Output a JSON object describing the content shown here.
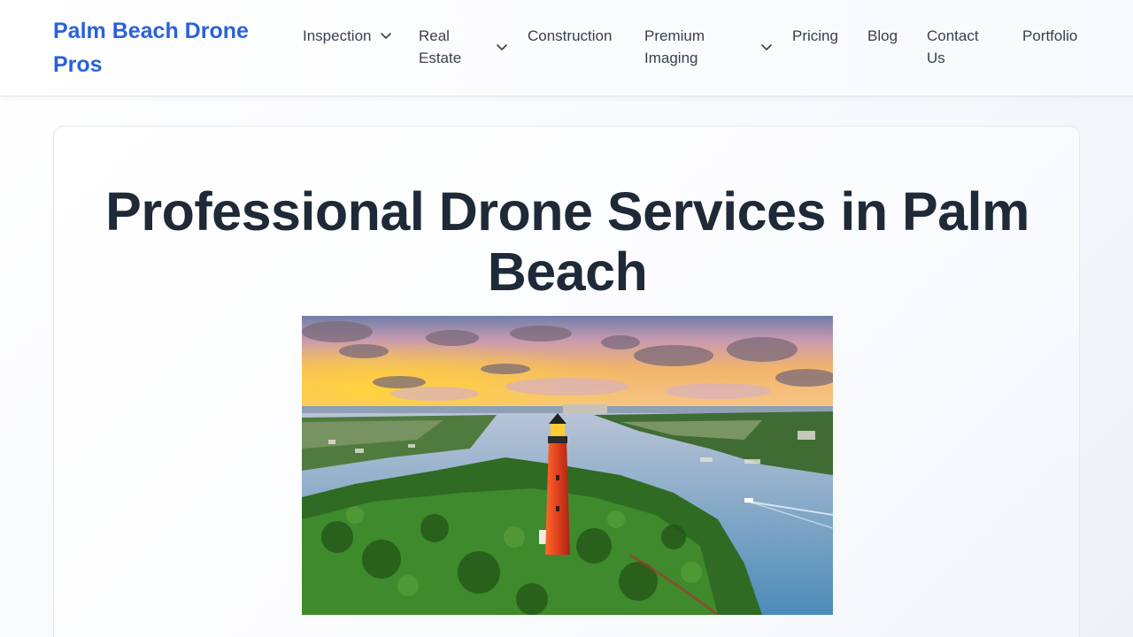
{
  "brand": {
    "name": "Palm Beach Drone Pros"
  },
  "nav": {
    "inspection": "Inspection",
    "real_estate": "Real Estate",
    "construction": "Construction",
    "premium_imaging": "Premium Imaging",
    "pricing": "Pricing",
    "blog": "Blog",
    "contact": "Contact Us",
    "portfolio": "Portfolio"
  },
  "hero": {
    "title": "Professional Drone Services in Palm Beach",
    "image_alt": "Aerial view of a red lighthouse on a green island at sunset"
  },
  "colors": {
    "brand": "#2b62d9",
    "text": "#1f2937",
    "nav_text": "#374151",
    "lighthouse": "#d9341f"
  },
  "icons": {
    "dropdown": "chevron-down-icon"
  }
}
